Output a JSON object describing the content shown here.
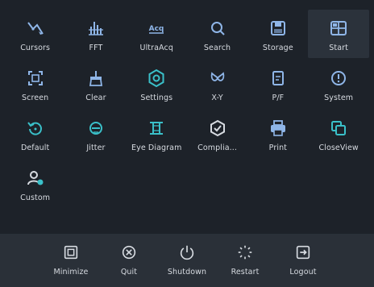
{
  "grid": {
    "items": [
      {
        "label": "Cursors",
        "icon": "cursors-icon",
        "color": "#8fb6e8"
      },
      {
        "label": "FFT",
        "icon": "fft-icon",
        "color": "#8fb6e8"
      },
      {
        "label": "UltraAcq",
        "icon": "acq-icon",
        "color": "#8fb6e8"
      },
      {
        "label": "Search",
        "icon": "search-icon",
        "color": "#8fb6e8"
      },
      {
        "label": "Storage",
        "icon": "storage-icon",
        "color": "#8fb6e8"
      },
      {
        "label": "Start",
        "icon": "start-icon",
        "color": "#8fb6e8"
      },
      {
        "label": "Screen",
        "icon": "screen-icon",
        "color": "#8fb6e8"
      },
      {
        "label": "Clear",
        "icon": "clear-icon",
        "color": "#8fb6e8"
      },
      {
        "label": "Settings",
        "icon": "settings-icon",
        "color": "#3ac0c9"
      },
      {
        "label": "X-Y",
        "icon": "xy-icon",
        "color": "#8fb6e8"
      },
      {
        "label": "P/F",
        "icon": "pf-icon",
        "color": "#8fb6e8"
      },
      {
        "label": "System",
        "icon": "system-icon",
        "color": "#8fb6e8"
      },
      {
        "label": "Default",
        "icon": "default-icon",
        "color": "#3ac0c9"
      },
      {
        "label": "Jitter",
        "icon": "jitter-icon",
        "color": "#3ac0c9"
      },
      {
        "label": "Eye Diagram",
        "icon": "eye-diagram-icon",
        "color": "#3ac0c9"
      },
      {
        "label": "Complia...",
        "icon": "compliance-icon",
        "color": "#d7dbe1"
      },
      {
        "label": "Print",
        "icon": "print-icon",
        "color": "#8fb6e8"
      },
      {
        "label": "CloseView",
        "icon": "closeview-icon",
        "color": "#3ac0c9"
      },
      {
        "label": "Custom",
        "icon": "custom-icon",
        "color": "#d7dbe1"
      }
    ]
  },
  "bottom_bar": {
    "items": [
      {
        "label": "Minimize",
        "icon": "minimize-icon"
      },
      {
        "label": "Quit",
        "icon": "quit-icon"
      },
      {
        "label": "Shutdown",
        "icon": "power-icon"
      },
      {
        "label": "Restart",
        "icon": "restart-icon"
      },
      {
        "label": "Logout",
        "icon": "logout-icon"
      }
    ]
  },
  "colors": {
    "background": "#1d2229",
    "bottom_bar": "#2a3038",
    "icon_blue": "#8fb6e8",
    "icon_teal": "#3ac0c9"
  }
}
